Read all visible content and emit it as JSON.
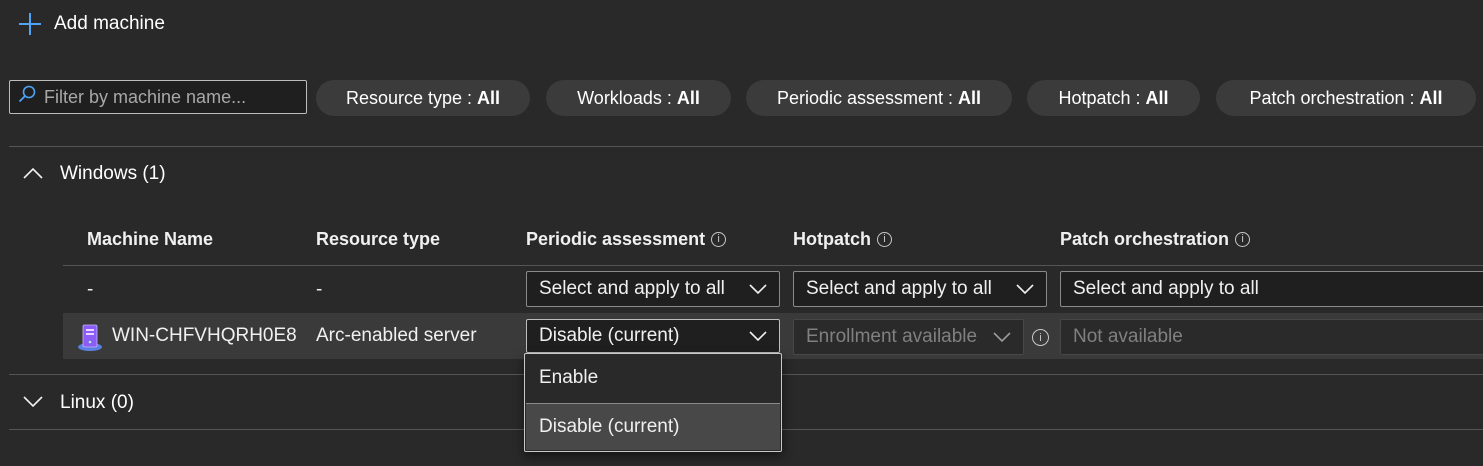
{
  "toolbar": {
    "add_label": "Add machine"
  },
  "filter": {
    "placeholder": "Filter by machine name..."
  },
  "pills": [
    {
      "label": "Resource type : ",
      "value": "All"
    },
    {
      "label": "Workloads : ",
      "value": "All"
    },
    {
      "label": "Periodic assessment : ",
      "value": "All"
    },
    {
      "label": "Hotpatch : ",
      "value": "All"
    },
    {
      "label": "Patch orchestration : ",
      "value": "All"
    }
  ],
  "groups": {
    "windows": {
      "label": "Windows (1)",
      "expanded": true
    },
    "linux": {
      "label": "Linux (0)",
      "expanded": false
    }
  },
  "table": {
    "headers": {
      "machine_name": "Machine Name",
      "resource_type": "Resource type",
      "periodic_assessment": "Periodic assessment",
      "hotpatch": "Hotpatch",
      "patch_orchestration": "Patch orchestration"
    },
    "bulk_row": {
      "machine_name": "-",
      "resource_type": "-",
      "periodic_assessment": "Select and apply to all",
      "hotpatch": "Select and apply to all",
      "patch_orchestration": "Select and apply to all"
    },
    "rows": [
      {
        "machine_name": "WIN-CHFVHQRH0E8",
        "resource_type": "Arc-enabled server",
        "periodic_assessment": "Disable (current)",
        "hotpatch": "Enrollment available",
        "patch_orchestration": "Not available"
      }
    ]
  },
  "dropdown_menu": {
    "options": [
      "Enable",
      "Disable (current)"
    ],
    "selected_index": 1
  },
  "colors": {
    "accent": "#4fa3f7",
    "background": "#292929",
    "row_highlight": "#3a3a3a"
  }
}
